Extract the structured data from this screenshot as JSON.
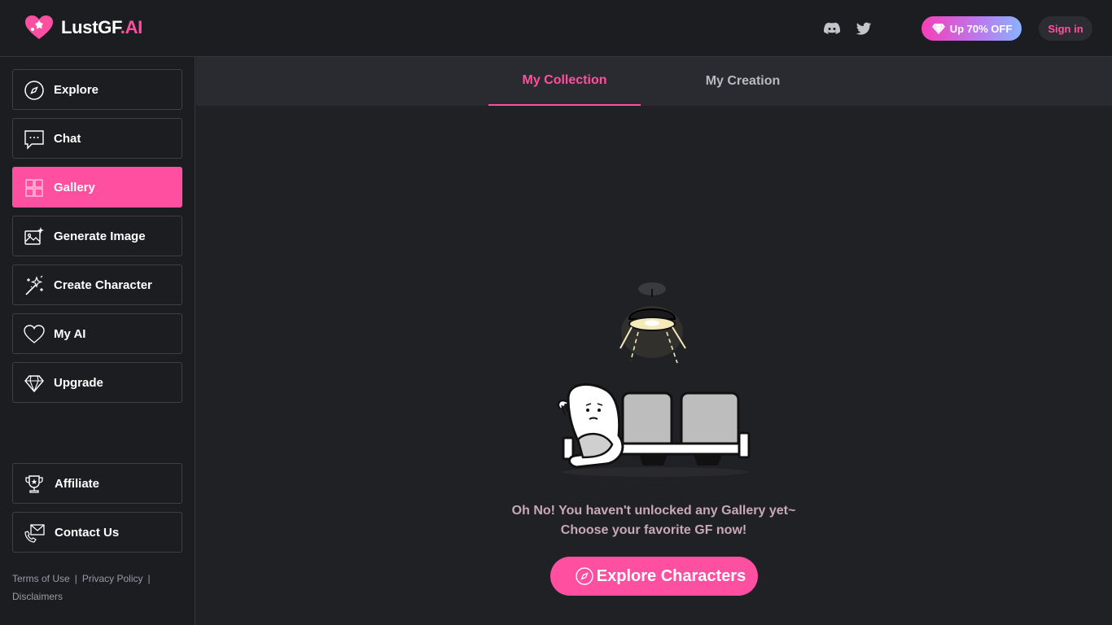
{
  "brand": {
    "name_main": "LustGF",
    "name_suffix": ".AI",
    "accent": "#ff4fa0"
  },
  "header": {
    "social": [
      {
        "icon": "discord-icon"
      },
      {
        "icon": "twitter-icon"
      }
    ],
    "promo_label": "Up 70% OFF",
    "signin_label": "Sign in"
  },
  "sidebar": {
    "items": [
      {
        "label": "Explore",
        "icon": "compass-icon"
      },
      {
        "label": "Chat",
        "icon": "chat-bubble-icon"
      },
      {
        "label": "Gallery",
        "icon": "gallery-grid-icon",
        "active": true
      },
      {
        "label": "Generate Image",
        "icon": "image-sparkle-icon"
      },
      {
        "label": "Create Character",
        "icon": "magic-wand-icon"
      },
      {
        "label": "My AI",
        "icon": "heart-icon"
      },
      {
        "label": "Upgrade",
        "icon": "diamond-icon"
      }
    ],
    "bottom_items": [
      {
        "label": "Affiliate",
        "icon": "trophy-icon"
      },
      {
        "label": "Contact Us",
        "icon": "envelope-phone-icon"
      }
    ],
    "footer": {
      "terms": "Terms of Use",
      "privacy": "Privacy Policy",
      "disclaimers": "Disclaimers"
    }
  },
  "main": {
    "tabs": [
      {
        "label": "My Collection",
        "active": true
      },
      {
        "label": "My Creation",
        "active": false
      }
    ],
    "empty_state": {
      "line1": "Oh No! You haven't unlocked any Gallery yet~",
      "line2": "Choose your favorite GF now!",
      "cta_label": "Explore Characters",
      "cta_icon": "compass-icon"
    }
  }
}
